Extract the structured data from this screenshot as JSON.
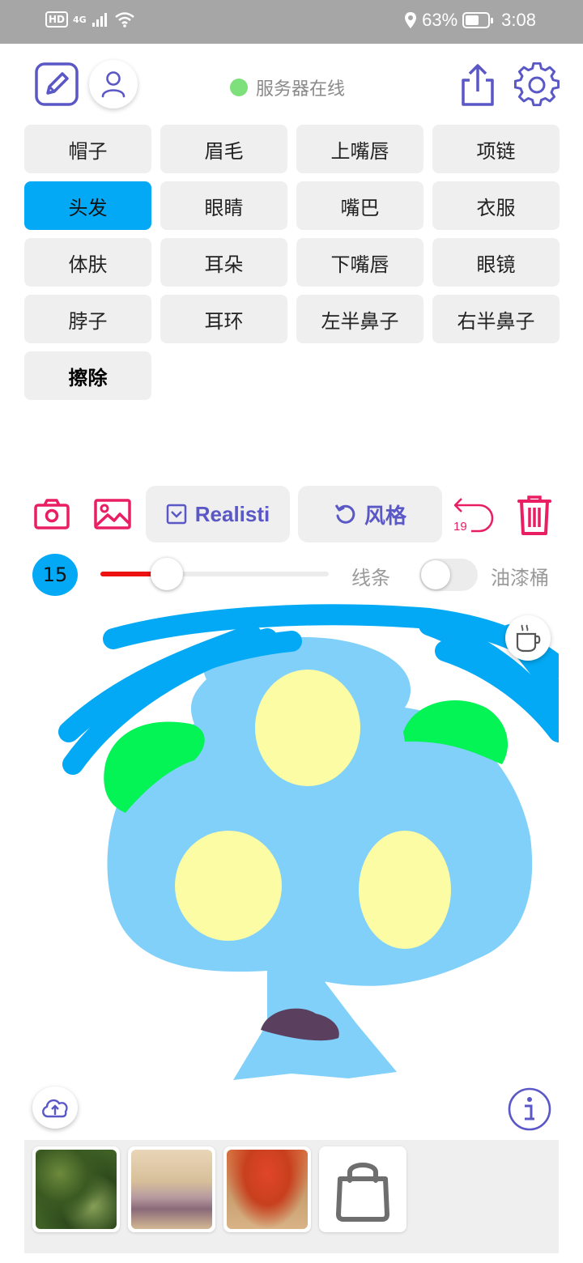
{
  "statusbar": {
    "hd": "HD",
    "network": "4G",
    "battery": "63%",
    "battery_level": 0.63,
    "time": "3:08"
  },
  "header": {
    "server_status": "服务器在线",
    "server_status_color": "#7ee07b"
  },
  "tags": [
    {
      "label": "帽子",
      "active": false
    },
    {
      "label": "眉毛",
      "active": false
    },
    {
      "label": "上嘴唇",
      "active": false
    },
    {
      "label": "项链",
      "active": false
    },
    {
      "label": "头发",
      "active": true
    },
    {
      "label": "眼睛",
      "active": false
    },
    {
      "label": "嘴巴",
      "active": false
    },
    {
      "label": "衣服",
      "active": false
    },
    {
      "label": "体肤",
      "active": false
    },
    {
      "label": "耳朵",
      "active": false
    },
    {
      "label": "下嘴唇",
      "active": false
    },
    {
      "label": "眼镜",
      "active": false
    },
    {
      "label": "脖子",
      "active": false
    },
    {
      "label": "耳环",
      "active": false
    },
    {
      "label": "左半鼻子",
      "active": false
    },
    {
      "label": "右半鼻子",
      "active": false
    },
    {
      "label": "擦除",
      "active": false
    }
  ],
  "toolbar": {
    "style_model": "Realisti",
    "style_button": "风格",
    "undo_count": "19"
  },
  "brush": {
    "size": "15",
    "size_fraction": 0.29,
    "line_label": "线条",
    "bucket_label": "油漆桶",
    "bucket_enabled": false
  },
  "colors": {
    "accent": "#5a57c6",
    "pink": "#e91e63",
    "active_tag": "#03a9f4",
    "slider_fill": "#ee1111"
  },
  "gallery": {
    "items": [
      "thumbnail-green-foliage",
      "thumbnail-rock-flowers",
      "thumbnail-red-tree"
    ],
    "store_icon": "shopping-bag-icon"
  }
}
